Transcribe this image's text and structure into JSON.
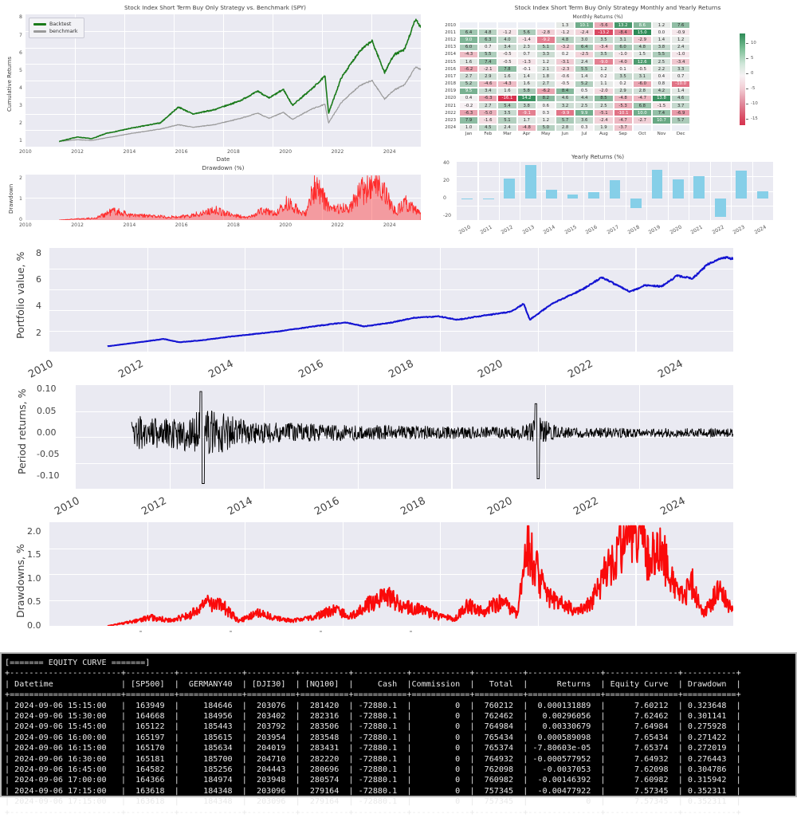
{
  "panels": {
    "cumret": {
      "title": "Stock Index Short Term Buy Only  Strategy vs. Benchmark (SPY)",
      "ylabel": "Cumulative Returns",
      "xlabel": "Date",
      "legend": [
        {
          "label": "Backtest",
          "color": "#1a7a1a"
        },
        {
          "label": "benchmark",
          "color": "#9a9a9a"
        }
      ],
      "yticks": [
        "1",
        "2",
        "3",
        "4",
        "5",
        "6",
        "7",
        "8"
      ],
      "xticks": [
        "2010",
        "2012",
        "2014",
        "2016",
        "2018",
        "2020",
        "2022",
        "2024"
      ]
    },
    "drawdown_small": {
      "title": "Drawdown (%)",
      "ylabel": "Drawdown",
      "yticks": [
        "0",
        "1",
        "2"
      ],
      "xticks": [
        "2010",
        "2012",
        "2014",
        "2016",
        "2018",
        "2020",
        "2022",
        "2024"
      ],
      "color": "#ff2b2b"
    },
    "heatmap": {
      "title": "Stock Index Short Term Buy Only  Strategy Monthly and Yearly Returns",
      "subtitle": "Monthly Returns (%)",
      "months": [
        "Jan",
        "Feb",
        "Mar",
        "Apr",
        "May",
        "Jun",
        "Jul",
        "Aug",
        "Sep",
        "Oct",
        "Nov",
        "Dec"
      ],
      "colorbar_ticks": [
        "10",
        "5",
        "0",
        "-5",
        "-10",
        "-15"
      ]
    },
    "yearly": {
      "title": "Yearly Returns (%)",
      "yticks": [
        "40",
        "20",
        "0",
        "-20"
      ],
      "color": "#86cfe8"
    },
    "portfolio": {
      "ylabel": "Portfolio value, %",
      "yticks": [
        "2",
        "4",
        "6",
        "8"
      ],
      "xticks": [
        "2010",
        "2012",
        "2014",
        "2016",
        "2018",
        "2020",
        "2022",
        "2024"
      ],
      "color": "#1414d2"
    },
    "period_returns": {
      "ylabel": "Period returns, %",
      "yticks": [
        "0.10",
        "0.05",
        "0.00",
        "-0.05",
        "-0.10"
      ],
      "xticks": [
        "2010",
        "2012",
        "2014",
        "2016",
        "2018",
        "2020",
        "2022",
        "2024"
      ],
      "color": "#000000"
    },
    "drawdowns_big": {
      "ylabel": "Drawdowns, %",
      "yticks": [
        "2.0",
        "1.5",
        "1.0",
        "0.5",
        "0.0"
      ],
      "color": "#fa0a0a"
    }
  },
  "chart_data": [
    {
      "type": "heatmap",
      "title": "Monthly Returns (%)",
      "x": [
        "Jan",
        "Feb",
        "Mar",
        "Apr",
        "May",
        "Jun",
        "Jul",
        "Aug",
        "Sep",
        "Oct",
        "Nov",
        "Dec"
      ],
      "y": [
        "2010",
        "2011",
        "2012",
        "2013",
        "2014",
        "2015",
        "2016",
        "2017",
        "2018",
        "2019",
        "2020",
        "2021",
        "2022",
        "2023",
        "2024"
      ],
      "zlim": [
        -16,
        15
      ],
      "values": [
        [
          null,
          null,
          null,
          null,
          null,
          1.3,
          10.1,
          -5.6,
          13.2,
          8.6,
          1.2,
          7.6
        ],
        [
          6.4,
          4.8,
          -1.2,
          5.6,
          -2.8,
          -1.2,
          -2.4,
          -13.2,
          -8.4,
          15.0,
          -0.0,
          -0.9
        ],
        [
          9.0,
          6.3,
          4.0,
          -1.4,
          -9.2,
          4.8,
          3.0,
          3.5,
          3.1,
          -2.9,
          1.4,
          1.2
        ],
        [
          6.0,
          0.7,
          3.4,
          2.3,
          5.1,
          -3.2,
          6.4,
          -3.4,
          6.0,
          4.8,
          3.8,
          2.4
        ],
        [
          -4.3,
          5.5,
          -0.5,
          0.7,
          3.3,
          0.2,
          -2.5,
          3.5,
          -1.0,
          1.5,
          5.5,
          -1.0
        ],
        [
          1.6,
          7.4,
          -0.5,
          -1.3,
          1.2,
          -3.1,
          2.4,
          -9.0,
          -4.0,
          12.6,
          2.5,
          -3.4
        ],
        [
          -6.2,
          -2.1,
          7.8,
          -0.1,
          2.1,
          -2.3,
          5.5,
          1.2,
          0.1,
          -0.5,
          2.2,
          3.3
        ],
        [
          2.7,
          2.9,
          1.6,
          1.4,
          1.8,
          -0.6,
          1.4,
          0.2,
          3.5,
          3.1,
          0.4,
          0.7
        ],
        [
          5.2,
          -4.6,
          -4.3,
          1.6,
          2.7,
          -0.5,
          5.2,
          1.1,
          0.2,
          -6.0,
          0.8,
          -10.0
        ],
        [
          9.5,
          3.4,
          1.6,
          5.8,
          -6.2,
          8.4,
          0.5,
          -2.0,
          2.9,
          2.8,
          4.2,
          1.4
        ],
        [
          0.4,
          -6.3,
          -16.1,
          14.2,
          8.2,
          4.6,
          4.4,
          8.5,
          -4.8,
          -4.7,
          13.8,
          4.6
        ],
        [
          -0.2,
          2.7,
          5.4,
          3.8,
          0.6,
          3.2,
          2.5,
          2.5,
          -5.3,
          6.8,
          -1.5,
          3.7
        ],
        [
          -6.3,
          -5.0,
          3.5,
          -9.1,
          0.3,
          -9.9,
          9.9,
          -5.1,
          -10.1,
          10.0,
          7.4,
          -6.9
        ],
        [
          7.9,
          -1.6,
          5.1,
          1.7,
          1.2,
          5.7,
          3.6,
          -2.4,
          -4.7,
          -2.7,
          10.7,
          5.7
        ],
        [
          1.0,
          4.5,
          2.4,
          -4.8,
          5.0,
          2.8,
          0.3,
          1.9,
          -3.7,
          null,
          null,
          null
        ]
      ]
    },
    {
      "type": "bar",
      "title": "Yearly Returns (%)",
      "categories": [
        "2010",
        "2011",
        "2012",
        "2013",
        "2014",
        "2015",
        "2016",
        "2017",
        "2018",
        "2019",
        "2020",
        "2021",
        "2022",
        "2023",
        "2024"
      ],
      "values": [
        0,
        -0.9,
        23,
        38.5,
        10,
        4,
        7.5,
        20.5,
        -11,
        33,
        21.5,
        25.5,
        -21.5,
        32,
        8.5
      ],
      "ylim": [
        -25,
        42
      ],
      "yticks": [
        40,
        20,
        0,
        -20
      ],
      "ylabel": "",
      "xlabel": ""
    },
    {
      "type": "line",
      "title": "Stock Index Short Term Buy Only  Strategy vs. Benchmark (SPY)",
      "xlabel": "Date",
      "ylabel": "Cumulative Returns",
      "ylim": [
        0.7,
        8.2
      ],
      "xlim": [
        "2010",
        "2025"
      ],
      "series": [
        {
          "name": "Backtest",
          "color": "#1a7a1a",
          "end_value": 7.6
        },
        {
          "name": "benchmark",
          "color": "#9a9a9a",
          "end_value": 5.2
        }
      ]
    },
    {
      "type": "area",
      "title": "Drawdown (%)",
      "ylabel": "Drawdown",
      "ylim": [
        0,
        2.2
      ],
      "max_drawdown": 2.1
    },
    {
      "type": "line",
      "title": "",
      "ylabel": "Portfolio value, %",
      "ylim": [
        0.6,
        8.4
      ],
      "end_value": 7.6
    },
    {
      "type": "line",
      "title": "",
      "ylabel": "Period returns, %",
      "ylim": [
        -0.13,
        0.11
      ]
    },
    {
      "type": "line",
      "title": "",
      "ylabel": "Drawdowns, %",
      "ylim": [
        0,
        2.2
      ],
      "max_drawdown": 2.1
    }
  ],
  "equity_table": {
    "banner": "[======= EQUITY CURVE =======]",
    "columns": [
      "Datetime",
      "[SP500]",
      "GERMANY40",
      "[DJI30]",
      "[NQ100]",
      "Cash",
      "Commission",
      "Total",
      "Returns",
      "Equity Curve",
      "Drawdown"
    ],
    "rows": [
      [
        "2024-09-06 15:15:00",
        "163949",
        "184646",
        "203076",
        "281420",
        "-72880.1",
        "0",
        "760212",
        "0.000131889",
        "7.60212",
        "0.323648"
      ],
      [
        "2024-09-06 15:30:00",
        "164668",
        "184956",
        "203402",
        "282316",
        "-72880.1",
        "0",
        "762462",
        "0.00296056",
        "7.62462",
        "0.301141"
      ],
      [
        "2024-09-06 15:45:00",
        "165122",
        "185443",
        "203792",
        "283506",
        "-72880.1",
        "0",
        "764984",
        "0.00330679",
        "7.64984",
        "0.275928"
      ],
      [
        "2024-09-06 16:00:00",
        "165197",
        "185615",
        "203954",
        "283548",
        "-72880.1",
        "0",
        "765434",
        "0.000589098",
        "7.65434",
        "0.271422"
      ],
      [
        "2024-09-06 16:15:00",
        "165170",
        "185634",
        "204019",
        "283431",
        "-72880.1",
        "0",
        "765374",
        "-7.80603e-05",
        "7.65374",
        "0.272019"
      ],
      [
        "2024-09-06 16:30:00",
        "165181",
        "185700",
        "204710",
        "282220",
        "-72880.1",
        "0",
        "764932",
        "-0.000577952",
        "7.64932",
        "0.276443"
      ],
      [
        "2024-09-06 16:45:00",
        "164582",
        "185256",
        "204443",
        "280696",
        "-72880.1",
        "0",
        "762098",
        "-0.0037053",
        "7.62098",
        "0.304786"
      ],
      [
        "2024-09-06 17:00:00",
        "164366",
        "184974",
        "203948",
        "280574",
        "-72880.1",
        "0",
        "760982",
        "-0.00146392",
        "7.60982",
        "0.315942"
      ],
      [
        "2024-09-06 17:15:00",
        "163618",
        "184348",
        "203096",
        "279164",
        "-72880.1",
        "0",
        "757345",
        "-0.00477922",
        "7.57345",
        "0.352311"
      ],
      [
        "2024-09-06 17:15:00",
        "163618",
        "184348",
        "203096",
        "279164",
        "-72880.1",
        "0",
        "757345",
        "0",
        "7.57345",
        "0.352311"
      ]
    ]
  }
}
